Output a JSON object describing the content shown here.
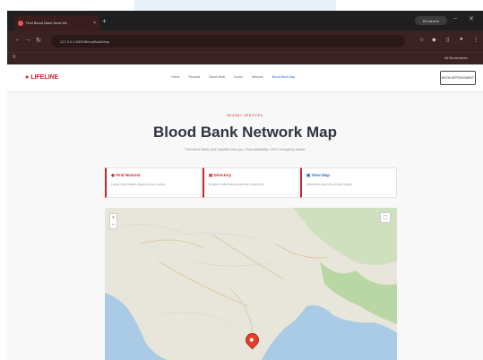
{
  "browser": {
    "tab_title": "Find Blood Bank Near Me",
    "tab_close": "×",
    "new_tab": "+",
    "url": "127.0.0.1:5500/BloodBankMap",
    "profile": "Re-launch",
    "bookmarks_right": "All Bookmarks"
  },
  "site": {
    "logo": "LIFELINE",
    "nav": [
      "Home",
      "Request",
      "Blood Bank",
      "Donor",
      "Network",
      "Blood Bank Map"
    ],
    "cta": "BOOK APPOINTMENT"
  },
  "hero": {
    "eyebrow": "NEARBY SERVICES",
    "title": "Blood Bank Network Map",
    "subtitle": "Find blood banks and hospitals near you • Real availability • 24x7 emergency details"
  },
  "cards": [
    {
      "title": "Find Nearest",
      "desc": "Locate blood banks closest to your location"
    },
    {
      "title": "Directory",
      "desc": "Browse verified banks and their contact info"
    },
    {
      "title": "View Map",
      "desc": "Interactive map with all blood banks"
    }
  ],
  "map": {
    "zoom_in": "+",
    "zoom_out": "−",
    "fullscreen": "⛶",
    "colors": {
      "land": "#e8e6da",
      "water": "#a9cbe6",
      "green": "#b9d7a5"
    }
  }
}
